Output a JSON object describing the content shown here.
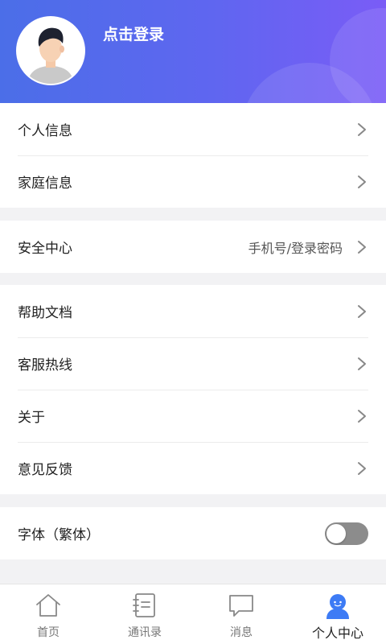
{
  "header": {
    "login_label": "点击登录",
    "avatar": "user-avatar"
  },
  "groups": [
    {
      "items": [
        {
          "label": "个人信息",
          "icon": "chevron-right-icon"
        },
        {
          "label": "家庭信息",
          "icon": "chevron-right-icon"
        }
      ]
    },
    {
      "items": [
        {
          "label": "安全中心",
          "value": "手机号/登录密码",
          "icon": "chevron-right-icon"
        }
      ]
    },
    {
      "items": [
        {
          "label": "帮助文档",
          "icon": "chevron-right-icon"
        },
        {
          "label": "客服热线",
          "icon": "chevron-right-icon"
        },
        {
          "label": "关于",
          "icon": "chevron-right-icon"
        },
        {
          "label": "意见反馈",
          "icon": "chevron-right-icon"
        }
      ]
    },
    {
      "items": [
        {
          "label": "字体（繁体）",
          "toggle_on": false
        }
      ]
    }
  ],
  "bottom_nav": {
    "items": [
      {
        "label": "首页",
        "icon": "home-icon",
        "active": false
      },
      {
        "label": "通讯录",
        "icon": "contacts-icon",
        "active": false
      },
      {
        "label": "消息",
        "icon": "message-icon",
        "active": false
      },
      {
        "label": "个人中心",
        "icon": "profile-icon",
        "active": true
      }
    ]
  },
  "colors": {
    "accent": "#4b6ee8",
    "header_gradient_end": "#7a5cf6",
    "active_nav": "#3d7bf5",
    "toggle_off": "#8c8c8c"
  }
}
